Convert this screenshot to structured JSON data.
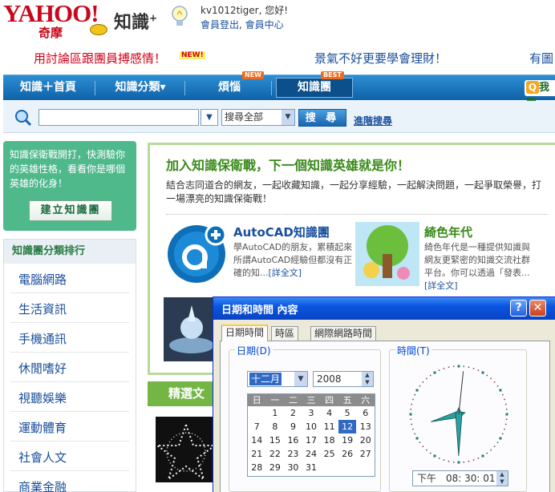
{
  "header": {
    "logo_text": "YAHOO!",
    "logo_sub": "奇摩",
    "product": "知識",
    "product_sup": "+",
    "greeting": "kv1012tiger, 您好!",
    "logout": "會員登出",
    "member_center": "會員中心",
    "promo1": "用討論區跟團員搏感情！",
    "promo1_badge": "NEW!",
    "promo2": "景氣不好更要學會理財！",
    "promo3": "有圖"
  },
  "nav": {
    "items": [
      {
        "label": "知識＋首頁"
      },
      {
        "label": "知識分類▾"
      },
      {
        "label": "煩惱",
        "badge": "NEW"
      },
      {
        "label": "知識團",
        "badge": "BEST"
      }
    ],
    "right_label": "我要"
  },
  "search": {
    "input_value": "",
    "scope": "搜尋全部",
    "button": "搜 尋",
    "advanced": "進階搜尋"
  },
  "sidebar": {
    "promo_text": "知識保衛戰開打，快測驗你的英雄性格，看看你是哪個英雄的化身！",
    "create_button": "建立知識團",
    "category_title": "知識團分類排行",
    "categories": [
      "電腦網路",
      "生活資訊",
      "手機通訊",
      "休閒嗜好",
      "視聽娛樂",
      "運動體育",
      "社會人文",
      "商業金融"
    ]
  },
  "main": {
    "title": "加入知識保衛戰，下一個知識英雄就是你！",
    "desc": "結合志同道合的網友，一起收藏知識，一起分享經驗，一起解決問題，一起爭取榮譽，打一場漂亮的知識保衛戰！",
    "card1": {
      "title": "AutoCAD知識團",
      "desc": "學AutoCAD的朋友，累積起來所謂AutoCAD經驗但都沒有正確的知...",
      "more": "[詳全文]"
    },
    "card2": {
      "title": "綺色年代",
      "desc": "綺色年代是一種提供知識與網友更緊密的知識交流社群平台。你可以透過「發表...",
      "more": "[詳全文]"
    },
    "featured": "精選文"
  },
  "dialog": {
    "title": "日期和時間 內容",
    "help": "?",
    "close": "✕",
    "tabs": [
      "日期時間",
      "時區",
      "網際網路時間"
    ],
    "date_group": "日期(D)",
    "time_group": "時間(T)",
    "month": "十二月",
    "year": "2008",
    "weekdays": [
      "日",
      "一",
      "二",
      "三",
      "四",
      "五",
      "六"
    ],
    "weeks": [
      [
        "",
        "1",
        "2",
        "3",
        "4",
        "5",
        "6"
      ],
      [
        "7",
        "8",
        "9",
        "10",
        "11",
        "12",
        "13"
      ],
      [
        "14",
        "15",
        "16",
        "17",
        "18",
        "19",
        "20"
      ],
      [
        "21",
        "22",
        "23",
        "24",
        "25",
        "26",
        "27"
      ],
      [
        "28",
        "29",
        "30",
        "31",
        "",
        "",
        ""
      ]
    ],
    "selected_day": "12",
    "time": "下午　08: 30: 01",
    "clock": {
      "hour": 8,
      "minute": 30,
      "second": 1
    }
  },
  "colors": {
    "yahoo_red": "#c8081c",
    "nav_blue": "#1a6fbf",
    "green": "#3a8a1a",
    "xp_title": "#0a55e0"
  }
}
